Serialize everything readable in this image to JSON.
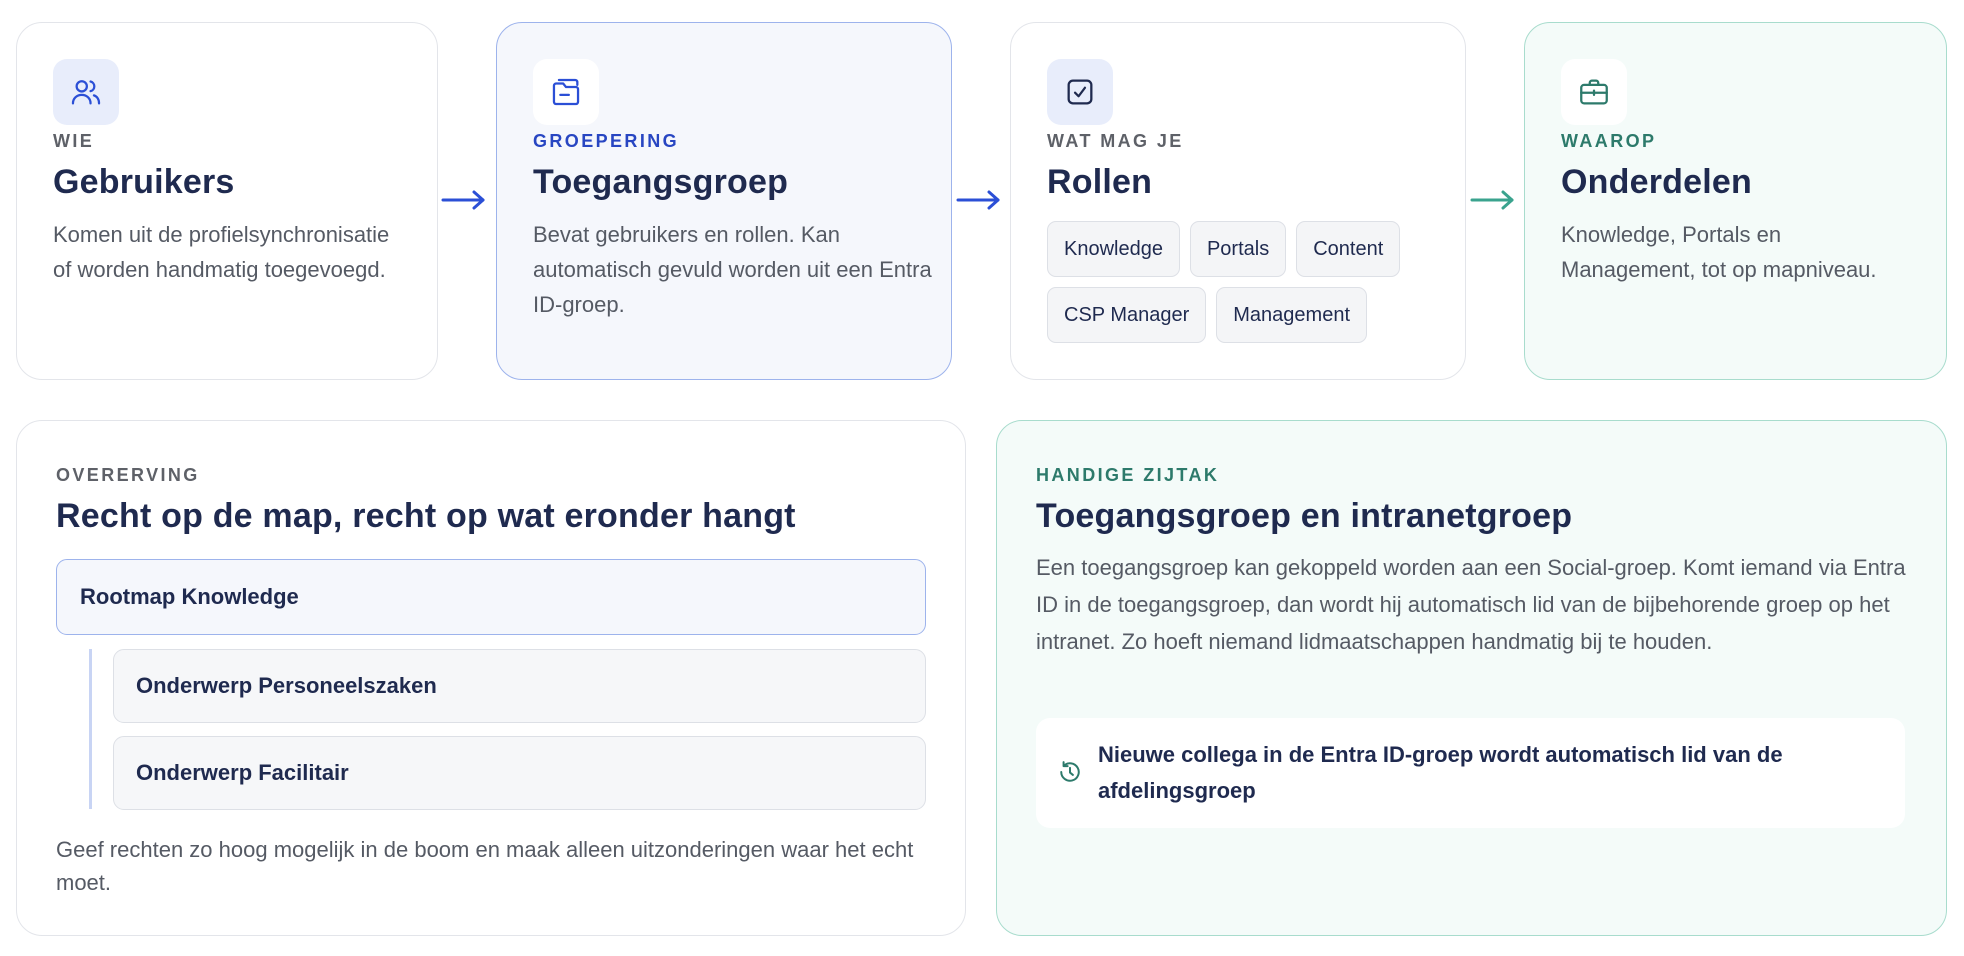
{
  "steps": [
    {
      "eyebrow": "WIE",
      "title": "Gebruikers",
      "description": "Komen uit de profielsynchronisatie of worden handmatig toegevoegd.",
      "icon": "users-icon"
    },
    {
      "eyebrow": "GROEPERING",
      "title": "Toegangsgroep",
      "description": "Bevat gebruikers en rollen. Kan automatisch gevuld worden uit een Entra ID-groep.",
      "icon": "folder-icon"
    },
    {
      "eyebrow": "WAT MAG JE",
      "title": "Rollen",
      "roles": [
        "Knowledge",
        "Portals",
        "Content",
        "CSP Manager",
        "Management"
      ],
      "icon": "checkbox-icon"
    },
    {
      "eyebrow": "WAAROP",
      "title": "Onderdelen",
      "description": "Knowledge, Portals en Management, tot op mapniveau.",
      "icon": "briefcase-icon"
    }
  ],
  "inheritance": {
    "eyebrow": "OVERERVING",
    "title": "Recht op de map, recht op wat eronder hangt",
    "root": "Rootmap Knowledge",
    "children": [
      "Onderwerp Personeelszaken",
      "Onderwerp Facilitair"
    ],
    "footer": "Geef rechten zo hoog mogelijk in de boom en maak alleen uitzonderingen waar het echt moet."
  },
  "sidenote": {
    "eyebrow": "HANDIGE ZIJTAK",
    "title": "Toegangsgroep en intranetgroep",
    "description": "Een toegangsgroep kan gekoppeld worden aan een Social-groep. Komt iemand via Entra ID in de toegangsgroep, dan wordt hij automatisch lid van de bijbehorende groep op het intranet. Zo hoeft niemand lidmaatschappen handmatig bij te houden.",
    "tip": "Nieuwe collega in de Entra ID-groep wordt automatisch lid van de afdelingsgroep",
    "tip_icon": "history-icon"
  },
  "colors": {
    "accent_blue": "#2b4fd6",
    "accent_teal": "#3aa38e",
    "title_navy": "#1f2a4f"
  }
}
